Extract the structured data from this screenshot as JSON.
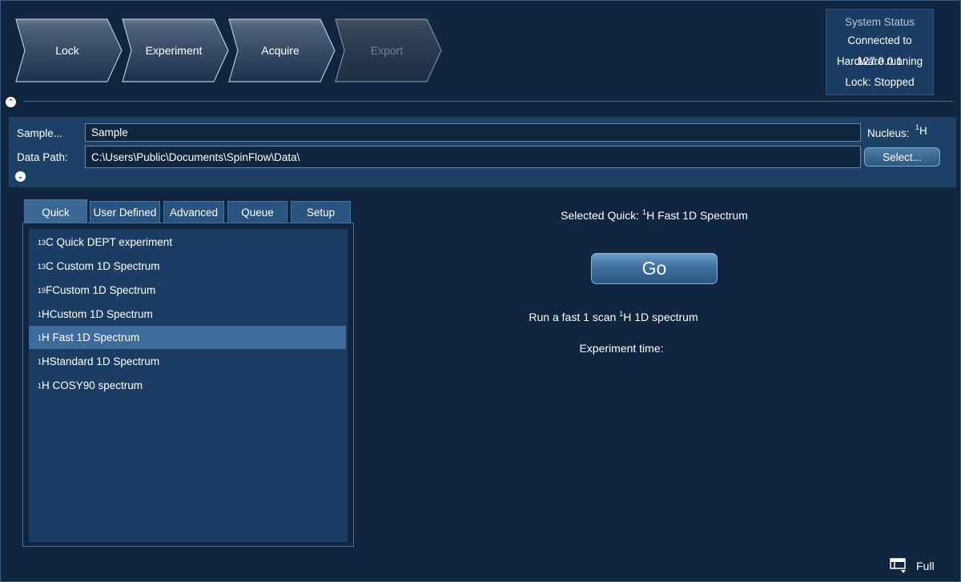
{
  "workflow": {
    "steps": [
      {
        "label": "Lock",
        "enabled": true
      },
      {
        "label": "Experiment",
        "enabled": true
      },
      {
        "label": "Acquire",
        "enabled": true
      },
      {
        "label": "Export",
        "enabled": false
      }
    ]
  },
  "system_status": {
    "title": "System Status",
    "connection": "Connected to 127.0.0.1",
    "hardware": "Hardware running",
    "lock": "Lock: Stopped"
  },
  "sample_panel": {
    "sample_label": "Sample...",
    "sample_value": "Sample",
    "data_path_label": "Data Path:",
    "data_path_value": "C:\\Users\\Public\\Documents\\SpinFlow\\Data\\",
    "nucleus_label": "Nucleus:",
    "nucleus_sup": "1",
    "nucleus_symbol": "H",
    "select_button": "Select..."
  },
  "tabs": [
    {
      "label": "Quick",
      "active": true
    },
    {
      "label": "User Defined",
      "active": false
    },
    {
      "label": "Advanced",
      "active": false
    },
    {
      "label": "Queue",
      "active": false
    },
    {
      "label": "Setup",
      "active": false
    }
  ],
  "experiments": [
    {
      "sup": "13",
      "text": "C Quick DEPT experiment",
      "selected": false
    },
    {
      "sup": "13",
      "text": "C Custom 1D Spectrum",
      "selected": false
    },
    {
      "sup": "19",
      "text": "FCustom 1D Spectrum",
      "selected": false
    },
    {
      "sup": "1",
      "text": "HCustom 1D Spectrum",
      "selected": false
    },
    {
      "sup": "1",
      "text": "H Fast 1D Spectrum",
      "selected": true
    },
    {
      "sup": "1",
      "text": "HStandard 1D Spectrum",
      "selected": false
    },
    {
      "sup": "1",
      "text": "H COSY90 spectrum",
      "selected": false
    }
  ],
  "details": {
    "selected_prefix": "Selected Quick: ",
    "selected_sup": "1",
    "selected_name": "H Fast 1D Spectrum",
    "go_button": "Go",
    "description_prefix": "Run a fast 1 scan ",
    "description_sup": "1",
    "description_suffix": "H 1D spectrum",
    "experiment_time_label": "Experiment time:"
  },
  "footer": {
    "full_label": "Full",
    "full_icon": "screen-layout-icon"
  },
  "colors": {
    "background": "#0f2540",
    "panel": "#1d4067",
    "selected_row": "#3e6b9a",
    "accent_button": "#3f6f9c"
  }
}
